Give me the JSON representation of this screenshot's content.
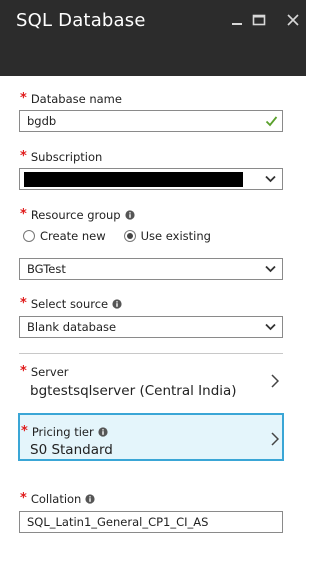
{
  "window": {
    "title": "SQL Database"
  },
  "database_name": {
    "label": "Database name",
    "value": "bgdb"
  },
  "subscription": {
    "label": "Subscription"
  },
  "resource_group": {
    "label": "Resource group",
    "options": [
      "Create new",
      "Use existing"
    ],
    "selected": "Use existing",
    "value": "BGTest"
  },
  "source": {
    "label": "Select source",
    "value": "Blank database"
  },
  "server": {
    "label": "Server",
    "value": "bgtestsqlserver (Central India)"
  },
  "pricing_tier": {
    "label": "Pricing tier",
    "value": "S0 Standard"
  },
  "collation": {
    "label": "Collation",
    "value": "SQL_Latin1_General_CP1_CI_AS"
  },
  "required_marker": "*",
  "colors": {
    "header_bg": "#2c2c2c",
    "required": "#e01c1c",
    "valid_check": "#5aa02c",
    "selected_border": "#3aa6d6",
    "selected_bg": "#e4f5fb"
  },
  "icons": [
    "minimize-icon",
    "maximize-icon",
    "close-icon",
    "check-icon",
    "chevron-down-icon",
    "chevron-right-icon",
    "info-icon"
  ]
}
